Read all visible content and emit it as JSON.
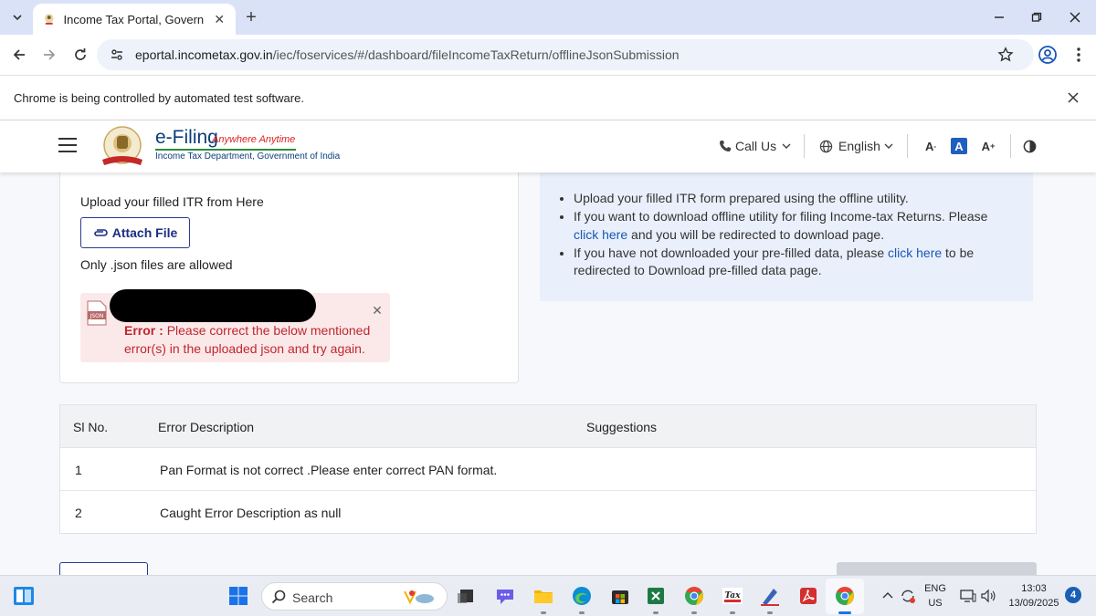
{
  "browser": {
    "tab_title": "Income Tax Portal, Government",
    "url_domain": "eportal.incometax.gov.in",
    "url_path": "/iec/foservices/#/dashboard/fileIncomeTaxReturn/offlineJsonSubmission",
    "infobar_text": "Chrome is being controlled by automated test software."
  },
  "header": {
    "brand_main": "e-Filing",
    "brand_tagline": "Anywhere Anytime",
    "brand_sub": "Income Tax Department, Government of India",
    "call_us": "Call Us",
    "language": "English"
  },
  "upload": {
    "label": "Upload your filled ITR from Here",
    "attach_button": "Attach File",
    "note": "Only .json files are allowed",
    "error_prefix": "Error :",
    "error_message": "Please correct the below mentioned error(s) in the uploaded json and try again."
  },
  "info": {
    "item1": "Upload your filled ITR form prepared using the offline utility.",
    "item2_pre": "If you want to download offline utility for filing Income-tax Returns. Please",
    "item2_link": "click here",
    "item2_post": "and you will be redirected to download page.",
    "item3_pre": "If you have not downloaded your pre-filled data, please",
    "item3_link": "click here",
    "item3_post": "to be redirected to Download pre-filled data page."
  },
  "table": {
    "headers": [
      "Sl No.",
      "Error Description",
      "Suggestions"
    ],
    "rows": [
      {
        "sl": "1",
        "description": "Pan Format is not correct .Please enter correct PAN format.",
        "suggestion": ""
      },
      {
        "sl": "2",
        "description": "Caught Error Description as null",
        "suggestion": ""
      }
    ]
  },
  "taskbar": {
    "search_placeholder": "Search",
    "lang_line1": "ENG",
    "lang_line2": "US",
    "time": "13:03",
    "date": "13/09/2025",
    "notification_count": "4"
  },
  "colors": {
    "tab_strip": "#dae2f8",
    "error_bg": "#fbe9ea",
    "error_text": "#c0272d",
    "link": "#1a56b8",
    "info_panel": "#e9f0fb",
    "primary_button": "#1c2d82"
  }
}
